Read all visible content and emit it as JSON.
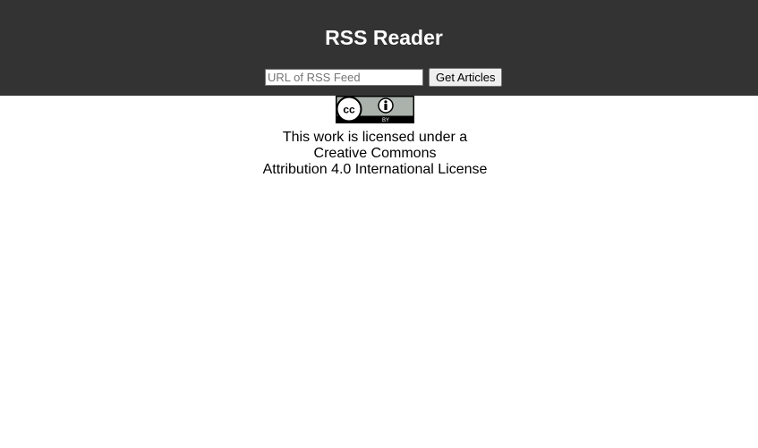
{
  "header": {
    "title": "RSS Reader"
  },
  "form": {
    "url_placeholder": "URL of RSS Feed",
    "url_value": "",
    "submit_label": "Get Articles"
  },
  "license": {
    "badge_text": "BY",
    "line1": "This work is licensed under a",
    "line2": "Creative Commons",
    "line3": "Attribution 4.0 International License"
  },
  "colors": {
    "header_bg": "#333333",
    "header_text": "#ffffff",
    "page_bg": "#ffffff"
  }
}
